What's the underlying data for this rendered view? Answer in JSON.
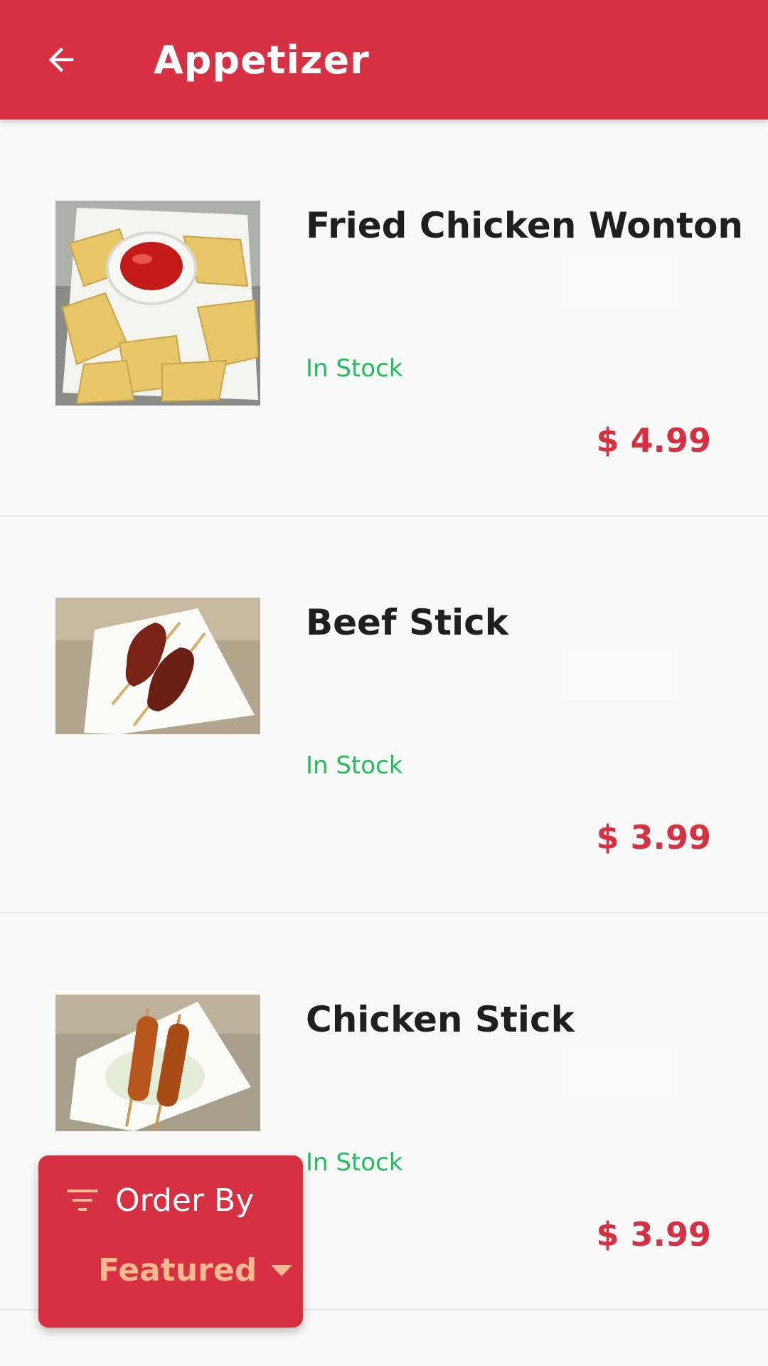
{
  "colors": {
    "accent": "#d63042",
    "in_stock": "#1fbf5a",
    "sort_value": "#f7b98f"
  },
  "appbar": {
    "title": "Appetizer",
    "back_icon": "arrow-back-icon"
  },
  "items": [
    {
      "name": "Fried Chicken Wonton",
      "stock": "In Stock",
      "price": "$ 4.99",
      "image": "fried-wonton-photo"
    },
    {
      "name": "Beef Stick",
      "stock": "In Stock",
      "price": "$ 3.99",
      "image": "beef-skewer-photo"
    },
    {
      "name": "Chicken Stick",
      "stock": "In Stock",
      "price": "$ 3.99",
      "image": "chicken-skewer-photo"
    }
  ],
  "sort": {
    "label": "Order By",
    "value": "Featured",
    "icon": "filter-icon",
    "caret_icon": "dropdown-caret-icon"
  }
}
